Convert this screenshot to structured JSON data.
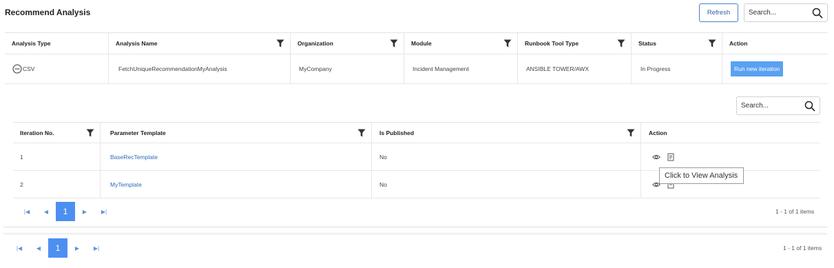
{
  "page": {
    "title": "Recommend Analysis",
    "refresh_label": "Refresh",
    "search_placeholder": "Search..."
  },
  "main_table": {
    "headers": [
      "Analysis Type",
      "Analysis Name",
      "Organization",
      "Module",
      "Runbook Tool Type",
      "Status",
      "Action"
    ],
    "row": {
      "type": "CSV",
      "name": "FetchUniqueRecommendationMyAnalysis",
      "organization": "MyCompany",
      "module": "Incident Management",
      "tool": "ANSIBLE TOWER/AWX",
      "status": "In Progress",
      "action_label": "Run new iteration"
    }
  },
  "iteration_table": {
    "search_placeholder": "Search...",
    "headers": [
      "Iteration No.",
      "Parameter Template",
      "Is Published",
      "Action"
    ],
    "rows": [
      {
        "iteration": "1",
        "template": "BaseRecTemplate",
        "published": "No"
      },
      {
        "iteration": "2",
        "template": "MyTemplate",
        "published": "No"
      }
    ],
    "tooltip": "Click to View Analysis",
    "pager": {
      "first": "|◀",
      "prev": "◀",
      "page": "1",
      "next": "▶",
      "last": "▶|",
      "summary": "1 - 1 of 1 items"
    }
  },
  "outer_pager": {
    "first": "|◀",
    "prev": "◀",
    "page": "1",
    "next": "▶",
    "last": "▶|",
    "summary": "1 - 1 of 1 items"
  },
  "colors": {
    "accent": "#4d8ff0",
    "button": "#5aa1f2",
    "link": "#2e6cb8"
  },
  "icons": [
    "search-icon",
    "filter-icon",
    "circle-minus-icon",
    "eye-icon",
    "document-icon",
    "first-page-icon",
    "prev-page-icon",
    "next-page-icon",
    "last-page-icon"
  ]
}
